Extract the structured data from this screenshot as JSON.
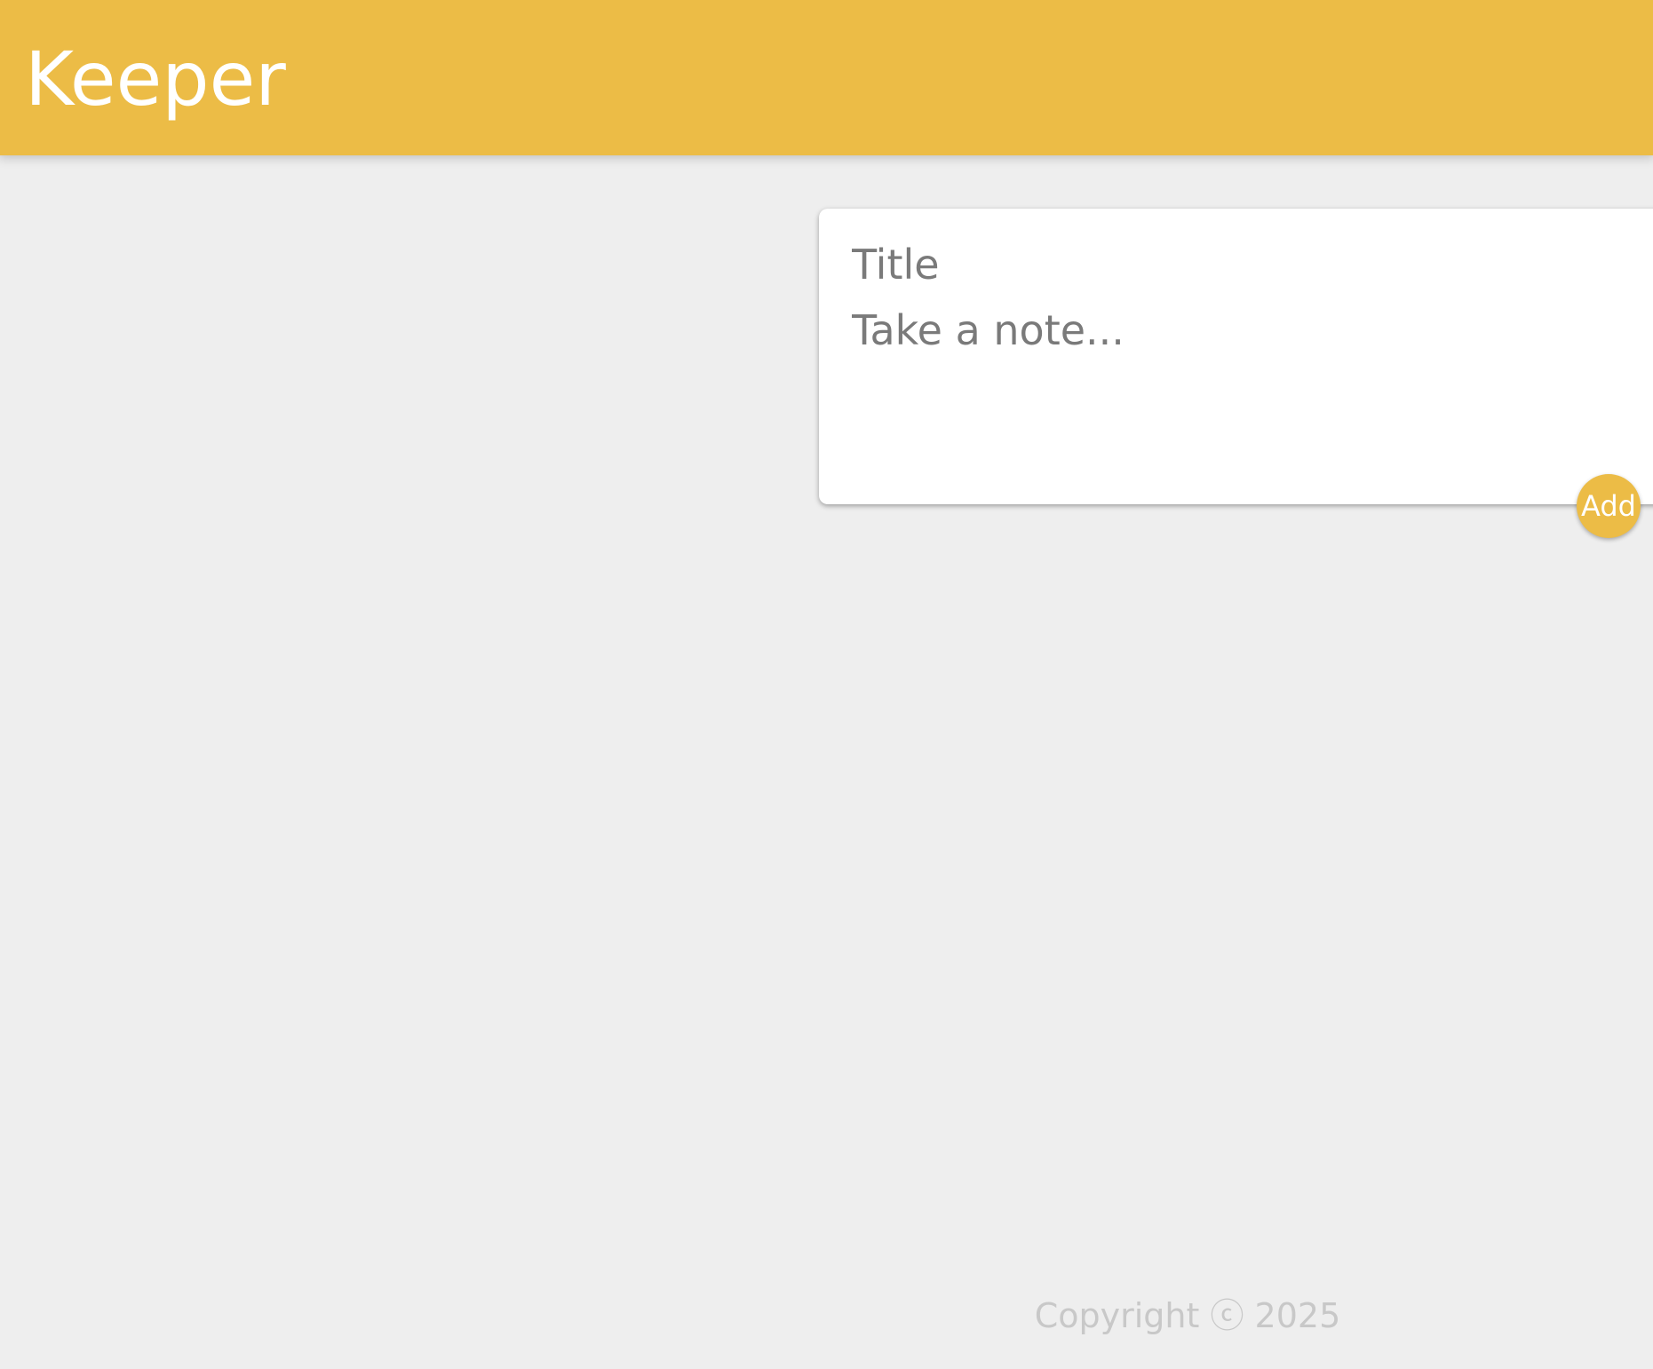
{
  "header": {
    "title": "Keeper",
    "color": "#ecbc46"
  },
  "create_note": {
    "title_placeholder": "Title",
    "title_value": "",
    "content_placeholder": "Take a note...",
    "content_value": "",
    "add_label": "Add"
  },
  "footer": {
    "text": "Copyright ⓒ 2025"
  },
  "colors": {
    "accent": "#ecbc46",
    "background": "#eeeeee",
    "placeholder_text": "#7a7a7a",
    "footer_text": "#c8c8c8"
  }
}
